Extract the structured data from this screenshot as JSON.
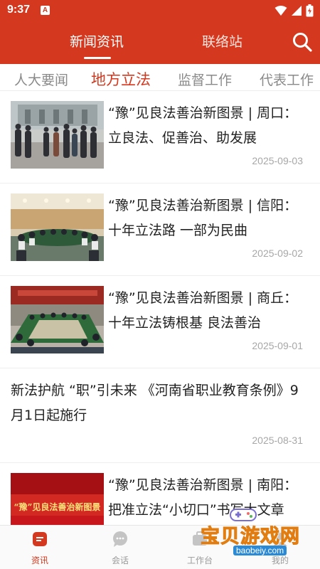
{
  "status_bar": {
    "time": "9:37",
    "notification_icon": "A"
  },
  "top_nav": {
    "tabs": [
      "新闻资讯",
      "联络站"
    ],
    "search_icon": "search-icon"
  },
  "categories": [
    "人大要闻",
    "地方立法",
    "监督工作",
    "代表工作"
  ],
  "news": [
    {
      "title": "“豫”见良法善治新图景 | 周口：立良法、促善治、助发展",
      "date": "2025-09-03",
      "thumb": "photo-outdoor-group"
    },
    {
      "title": "“豫”见良法善治新图景 | 信阳：十年立法路 一部为民曲",
      "date": "2025-09-02",
      "thumb": "photo-meeting-room"
    },
    {
      "title": "“豫”见良法善治新图景 | 商丘：十年立法铸根基 良法善治",
      "date": "2025-09-01",
      "thumb": "photo-conference-table"
    },
    {
      "title": "新法护航 “职”引未来 《河南省职业教育条例》9月1日起施行",
      "date": "2025-08-31",
      "thumb": ""
    },
    {
      "title": "“豫”见良法善治新图景 | 南阳：把准立法“小切口”书写大文章",
      "date": "",
      "thumb": "banner-red"
    }
  ],
  "banner_text": "“豫”见良法善治新图景",
  "bottom_nav": [
    {
      "label": "资讯",
      "icon": "news-icon",
      "active": true
    },
    {
      "label": "会话",
      "icon": "chat-icon",
      "active": false
    },
    {
      "label": "工作台",
      "icon": "workbench-icon",
      "active": false
    },
    {
      "label": "我的",
      "icon": "profile-icon",
      "active": false
    }
  ],
  "watermark": {
    "text": "宝贝游戏网",
    "url": "baobeiy.com"
  },
  "colors": {
    "brand_red": "#d4381e",
    "muted_text": "#8a8a8a",
    "date_text": "#a7a7a7"
  }
}
